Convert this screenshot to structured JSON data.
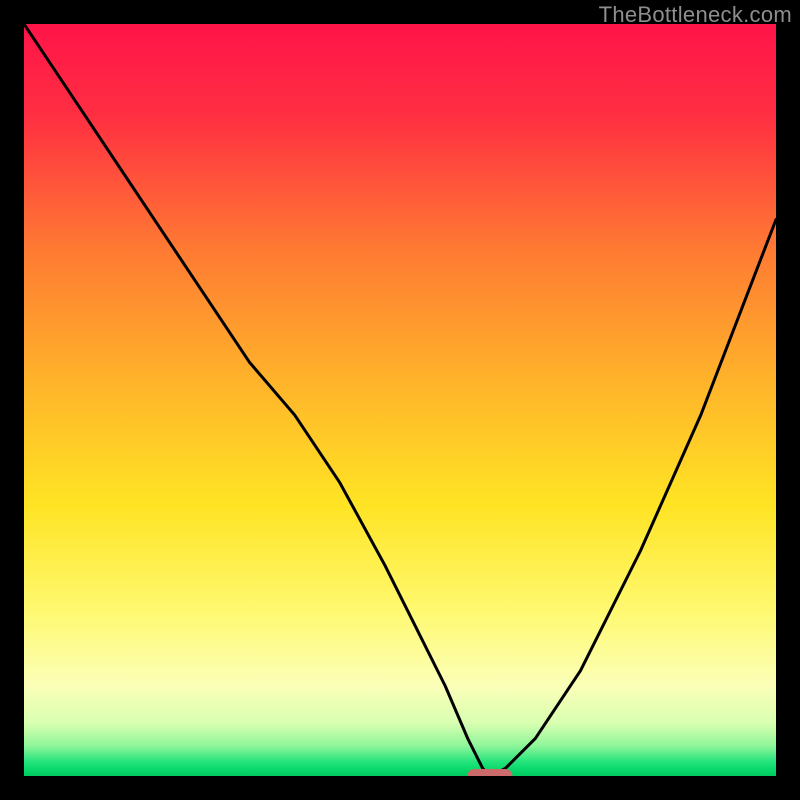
{
  "watermark": "TheBottleneck.com",
  "chart_data": {
    "type": "line",
    "title": "",
    "xlabel": "",
    "ylabel": "",
    "xlim": [
      0,
      100
    ],
    "ylim": [
      0,
      100
    ],
    "optimal_x": 62,
    "series": [
      {
        "name": "bottleneck-curve",
        "x": [
          0,
          6,
          12,
          18,
          24,
          30,
          36,
          42,
          48,
          52,
          56,
          59,
          61,
          62,
          64,
          68,
          74,
          82,
          90,
          100
        ],
        "y": [
          100,
          91,
          82,
          73,
          64,
          55,
          48,
          39,
          28,
          20,
          12,
          5,
          1,
          0,
          1,
          5,
          14,
          30,
          48,
          74
        ]
      }
    ],
    "gradient_stops": [
      {
        "pct": 0,
        "color": "#ff1449"
      },
      {
        "pct": 12,
        "color": "#ff2e42"
      },
      {
        "pct": 30,
        "color": "#ff7a33"
      },
      {
        "pct": 48,
        "color": "#ffb52a"
      },
      {
        "pct": 64,
        "color": "#ffe424"
      },
      {
        "pct": 78,
        "color": "#fff970"
      },
      {
        "pct": 88,
        "color": "#fbffb8"
      },
      {
        "pct": 93,
        "color": "#d8ffb0"
      },
      {
        "pct": 96,
        "color": "#8ef59a"
      },
      {
        "pct": 98.2,
        "color": "#20e37a"
      },
      {
        "pct": 99.2,
        "color": "#08d76a"
      },
      {
        "pct": 100,
        "color": "#00c85f"
      }
    ],
    "marker": {
      "x": 62,
      "y": 0,
      "width_pct": 6
    }
  }
}
